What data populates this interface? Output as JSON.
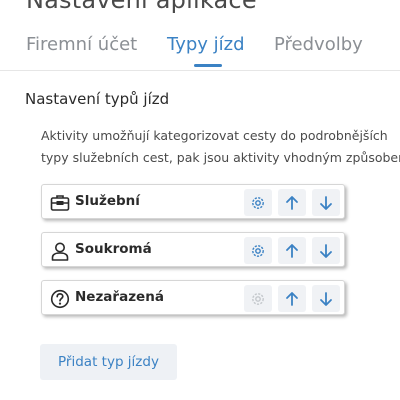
{
  "header": {
    "title": "Nastavení aplikace"
  },
  "tabs": [
    {
      "label": "Firemní účet"
    },
    {
      "label": "Typy jízd"
    },
    {
      "label": "Předvolby"
    }
  ],
  "section": {
    "title": "Nastavení typů jízd",
    "description_lines": [
      "Aktivity umožňují kategorizovat cesty do podrobnějších",
      "typy služebních cest, pak jsou aktivity vhodným způsobem"
    ]
  },
  "trip_types": [
    {
      "label": "Služební",
      "icon": "briefcase-icon",
      "settings_enabled": true
    },
    {
      "label": "Soukromá",
      "icon": "person-icon",
      "settings_enabled": true
    },
    {
      "label": "Nezařazená",
      "icon": "question-icon",
      "settings_enabled": false
    }
  ],
  "actions": {
    "add_label": "Přidat typ jízdy"
  },
  "colors": {
    "accent": "#3b82c4",
    "disabled": "#c4c8cc",
    "button_bg": "#f0f2f5"
  }
}
